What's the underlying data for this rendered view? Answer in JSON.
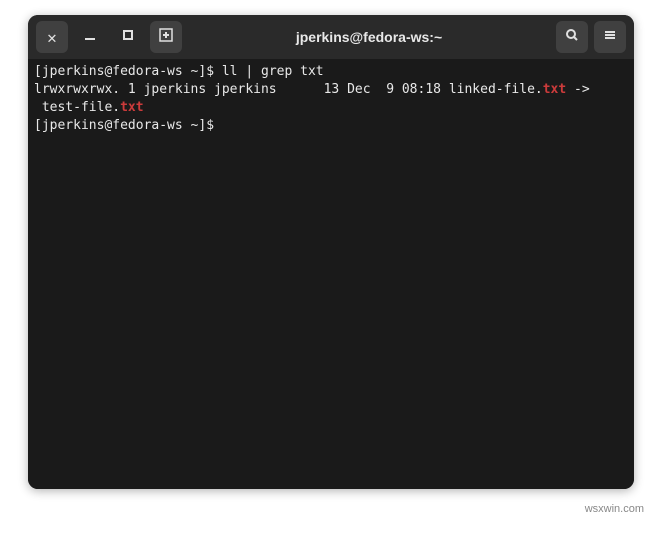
{
  "window": {
    "title": "jperkins@fedora-ws:~"
  },
  "terminal": {
    "line1": {
      "prompt_open": "[",
      "prompt_user": "jperkins@fedora-ws ~",
      "prompt_close": "]",
      "prompt_dollar": "$ ",
      "command": "ll | grep txt"
    },
    "line2": {
      "perms": "lrwxrwxrwx. 1 jperkins jperkins      13 Dec  9 08:18 linked-file.",
      "match1": "txt",
      "arrow": " ->"
    },
    "line3": {
      "leading": " test-file.",
      "match2": "txt"
    },
    "line4": {
      "prompt_open": "[",
      "prompt_user": "jperkins@fedora-ws ~",
      "prompt_close": "]",
      "prompt_dollar": "$ "
    }
  },
  "footer": "wsxwin.com"
}
